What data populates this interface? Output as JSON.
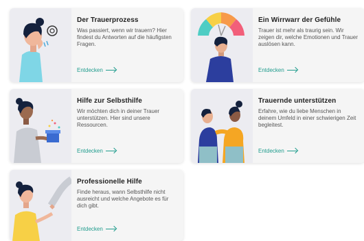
{
  "cards": [
    {
      "title": "Der Trauerprozess",
      "text": "Was passiert, wenn wir trauern? Hier findest du Antworten auf die häufigsten Fragen.",
      "cta": "Entdecken"
    },
    {
      "title": "Ein Wirrwarr der Gefühle",
      "text": "Trauer ist mehr als traurig sein. Wir zeigen dir, welche Emotionen und Trauer auslösen kann.",
      "cta": "Entdecken"
    },
    {
      "title": "Hilfe zur Selbsthilfe",
      "text": "Wir möchten dich in deiner Trauer unterstützen. Hier sind unsere Ressourcen.",
      "cta": "Entdecken"
    },
    {
      "title": "Trauernde unterstützen",
      "text": "Erfahre, wie du liebe Menschen in deinem Umfeld in einer schwierigen Zeit begleitest.",
      "cta": "Entdecken"
    },
    {
      "title": "Professionelle Hilfe",
      "text": "Finde heraus, wann Selbsthilfe nicht ausreicht und welche Angebote es für dich gibt.",
      "cta": "Entdecken"
    }
  ],
  "colors": {
    "accent": "#1f9c8d",
    "card_bg": "#f5f5f5",
    "illustration_bg": "#ececf1"
  },
  "icons": [
    "arrow-right-icon"
  ]
}
